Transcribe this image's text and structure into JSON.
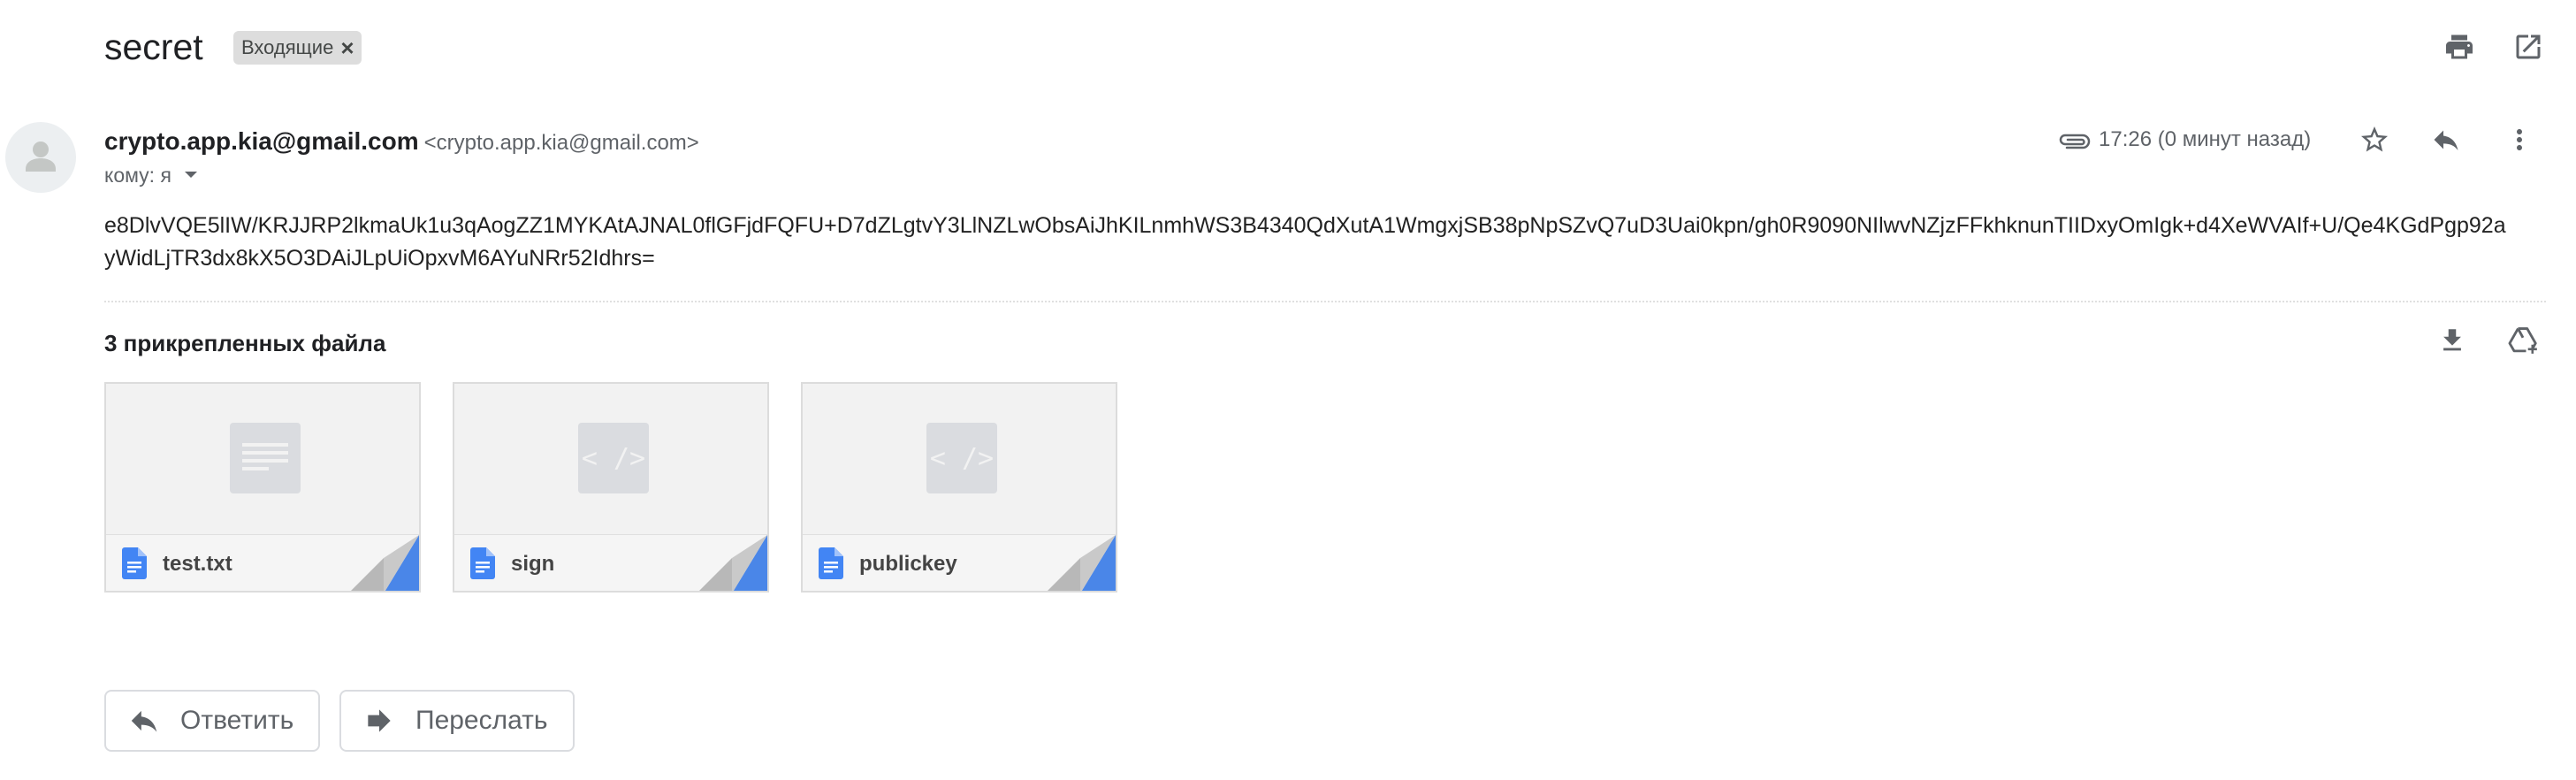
{
  "message": {
    "subject": "secret",
    "label": "Входящие",
    "label_remove": "×",
    "sender_name": "crypto.app.kia@gmail.com",
    "sender_email": "<crypto.app.kia@gmail.com>",
    "to_line": "кому: я",
    "time": "17:26 (0 минут назад)",
    "body": "e8DlvVQE5lIW/KRJJRP2lkmaUk1u3qAogZZ1MYKAtAJNAL0flGFjdFQFU+D7dZLgtvY3LlNZLwObsAiJhKILnmhWS3B4340QdXutA1WmgxjSB38pNpSZvQ7uD3Uai0kpn/gh0R9090NIlwvNZjzFFkhknunTIIDxyOmIgk+d4XeWVAIf+U/Qe4KGdPgp92ayWidLjTR3dx8kX5O3DAiJLpUiOpxvM6AYuNRr52Idhrs="
  },
  "attachments": {
    "title": "3 прикрепленных файла",
    "files": [
      {
        "name": "test.txt",
        "kind": "text"
      },
      {
        "name": "sign",
        "kind": "code"
      },
      {
        "name": "publickey",
        "kind": "code"
      }
    ]
  },
  "actions": {
    "reply": "Ответить",
    "forward": "Переслать"
  },
  "icons": {
    "print": "print-icon",
    "open_new_window": "open-in-new-window-icon",
    "attachment": "paperclip-icon",
    "star": "star-icon",
    "reply": "reply-icon",
    "more": "more-vertical-icon",
    "download_all": "download-icon",
    "save_to_drive": "add-to-drive-icon",
    "doc": "google-docs-icon"
  },
  "colors": {
    "accent_blue": "#4285f4",
    "doc_icon_blue": "#4285f4",
    "icon_gray": "#5f6368"
  }
}
